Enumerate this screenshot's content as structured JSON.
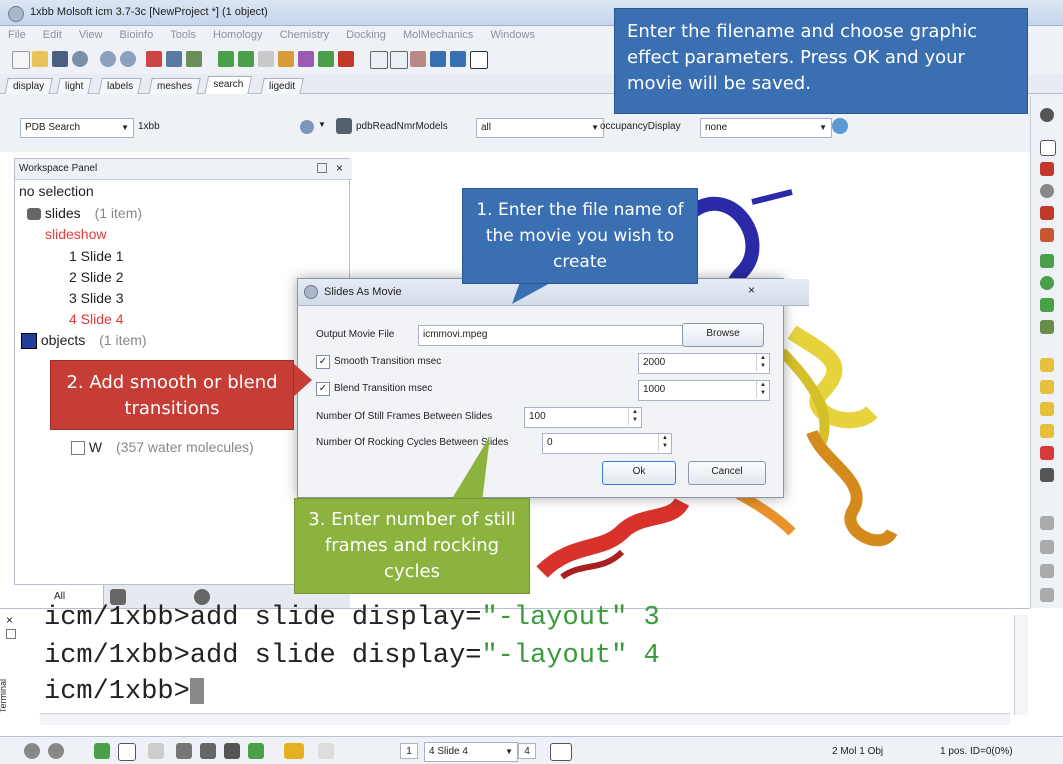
{
  "window": {
    "title": "1xbb Molsoft icm 3.7-3c  [NewProject *] (1 object)"
  },
  "menu": [
    "File",
    "Edit",
    "View",
    "Bioinfo",
    "Tools",
    "Homology",
    "Chemistry",
    "Docking",
    "MolMechanics",
    "Windows"
  ],
  "tabs": [
    "display",
    "light",
    "labels",
    "meshes",
    "search",
    "ligedit"
  ],
  "active_tab": "search",
  "searchbar": {
    "db_select": "PDB Search",
    "query": "1xbb",
    "field1_label": "pdbReadNmrModels",
    "field1_value": "all",
    "field2_label": "occupancyDisplay",
    "field2_value": "none"
  },
  "workspace": {
    "title": "Workspace Panel",
    "status": "no selection",
    "slides": {
      "label": "slides",
      "count": "(1 item)"
    },
    "slideshow": "slideshow",
    "slide_items": [
      "1 Slide 1",
      "2 Slide 2",
      "3 Slide 3",
      "4 Slide 4"
    ],
    "objects": {
      "label": "objects",
      "count": "(1 item)"
    },
    "water": {
      "label": "W",
      "count": "(357 water molecules)"
    }
  },
  "bottom_tabs": {
    "all": "All"
  },
  "terminal": {
    "side_label": "Terminal",
    "lines": [
      {
        "prompt": "icm/1xbb>",
        "cmd": "add slide display=",
        "arg": "\"-layout\"",
        "num": " 3"
      },
      {
        "prompt": "icm/1xbb>",
        "cmd": "add slide display=",
        "arg": "\"-layout\"",
        "num": " 4"
      }
    ],
    "current_prompt": "icm/1xbb>"
  },
  "statusbar": {
    "slide_num": "1",
    "slide_select": "4 Slide 4",
    "slide_total": "4",
    "info1": "2 Mol 1 Obj",
    "info2": "1 pos. ID=0(0%)"
  },
  "dialog": {
    "title": "Slides As Movie",
    "output_label": "Output Movie File",
    "output_value": "icmmovi.mpeg",
    "browse": "Browse",
    "smooth_label": "Smooth Transition msec",
    "smooth_value": "2000",
    "blend_label": "Blend Transition msec",
    "blend_value": "1000",
    "still_label": "Number Of Still Frames Between Slides",
    "still_value": "100",
    "rocking_label": "Number Of Rocking Cycles Between Slides",
    "rocking_value": "0",
    "ok": "Ok",
    "cancel": "Cancel"
  },
  "callouts": {
    "top": "Enter the filename and choose graphic effect parameters. Press OK and your movie will be saved.",
    "step1": "1. Enter the file name of the movie you wish to create",
    "step2": "2. Add smooth or blend transitions",
    "step3": "3. Enter number of still frames and rocking cycles"
  }
}
